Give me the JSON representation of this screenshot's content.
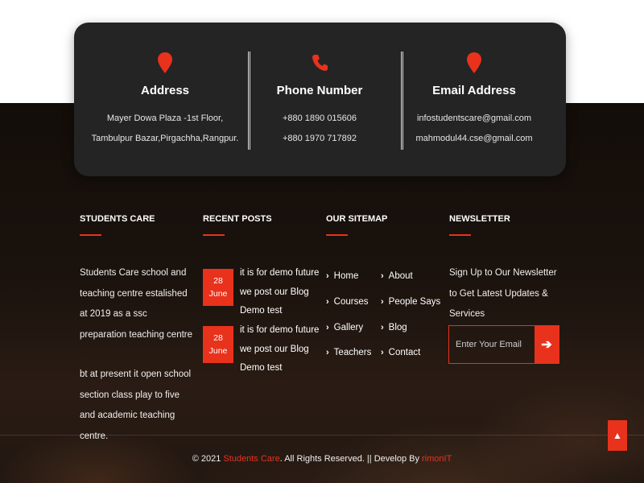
{
  "info_card": {
    "address": {
      "icon": "map-pin-icon",
      "title": "Address",
      "lines": [
        "Mayer Dowa Plaza -1st Floor,",
        "Tambulpur Bazar,Pirgachha,Rangpur."
      ]
    },
    "phone": {
      "icon": "phone-icon",
      "title": "Phone Number",
      "lines": [
        "+880 1890 015606",
        "+880 1970 717892"
      ]
    },
    "email": {
      "icon": "map-pin-icon",
      "title": "Email Address",
      "lines": [
        "infostudentscare@gmail.com",
        "mahmodul44.cse@gmail.com"
      ]
    }
  },
  "students_care": {
    "heading": "STUDENTS CARE",
    "paragraph1": "Students Care school and teaching centre estalished at 2019 as a ssc preparation teaching centre",
    "paragraph2": "bt at present it open school section class play to five and academic teaching centre."
  },
  "recent_posts": {
    "heading": "RECENT POSTS",
    "posts": [
      {
        "day": "28",
        "month": "June",
        "title": "it is for demo future we post our Blog Demo test"
      },
      {
        "day": "28",
        "month": "June",
        "title": "it is for demo future we post our Blog Demo test"
      }
    ]
  },
  "sitemap": {
    "heading": "OUR SITEMAP",
    "left": [
      "Home",
      "Courses",
      "Gallery",
      "Teachers"
    ],
    "right": [
      "About",
      "People Says",
      "Blog",
      "Contact"
    ]
  },
  "newsletter": {
    "heading": "NEWSLETTER",
    "text": "Sign Up to Our Newsletter to Get Latest Updates & Services",
    "placeholder": "Enter Your Email",
    "send_icon": "arrow-right-icon"
  },
  "footer": {
    "copyright_prefix": "© 2021 ",
    "brand": "Students Care",
    "middle": ". All Rights Reserved. || Develop By ",
    "developer": "rimonIT",
    "scroll_icon": "chevron-up-icon"
  },
  "colors": {
    "accent": "#e8321c",
    "card": "#242424"
  }
}
